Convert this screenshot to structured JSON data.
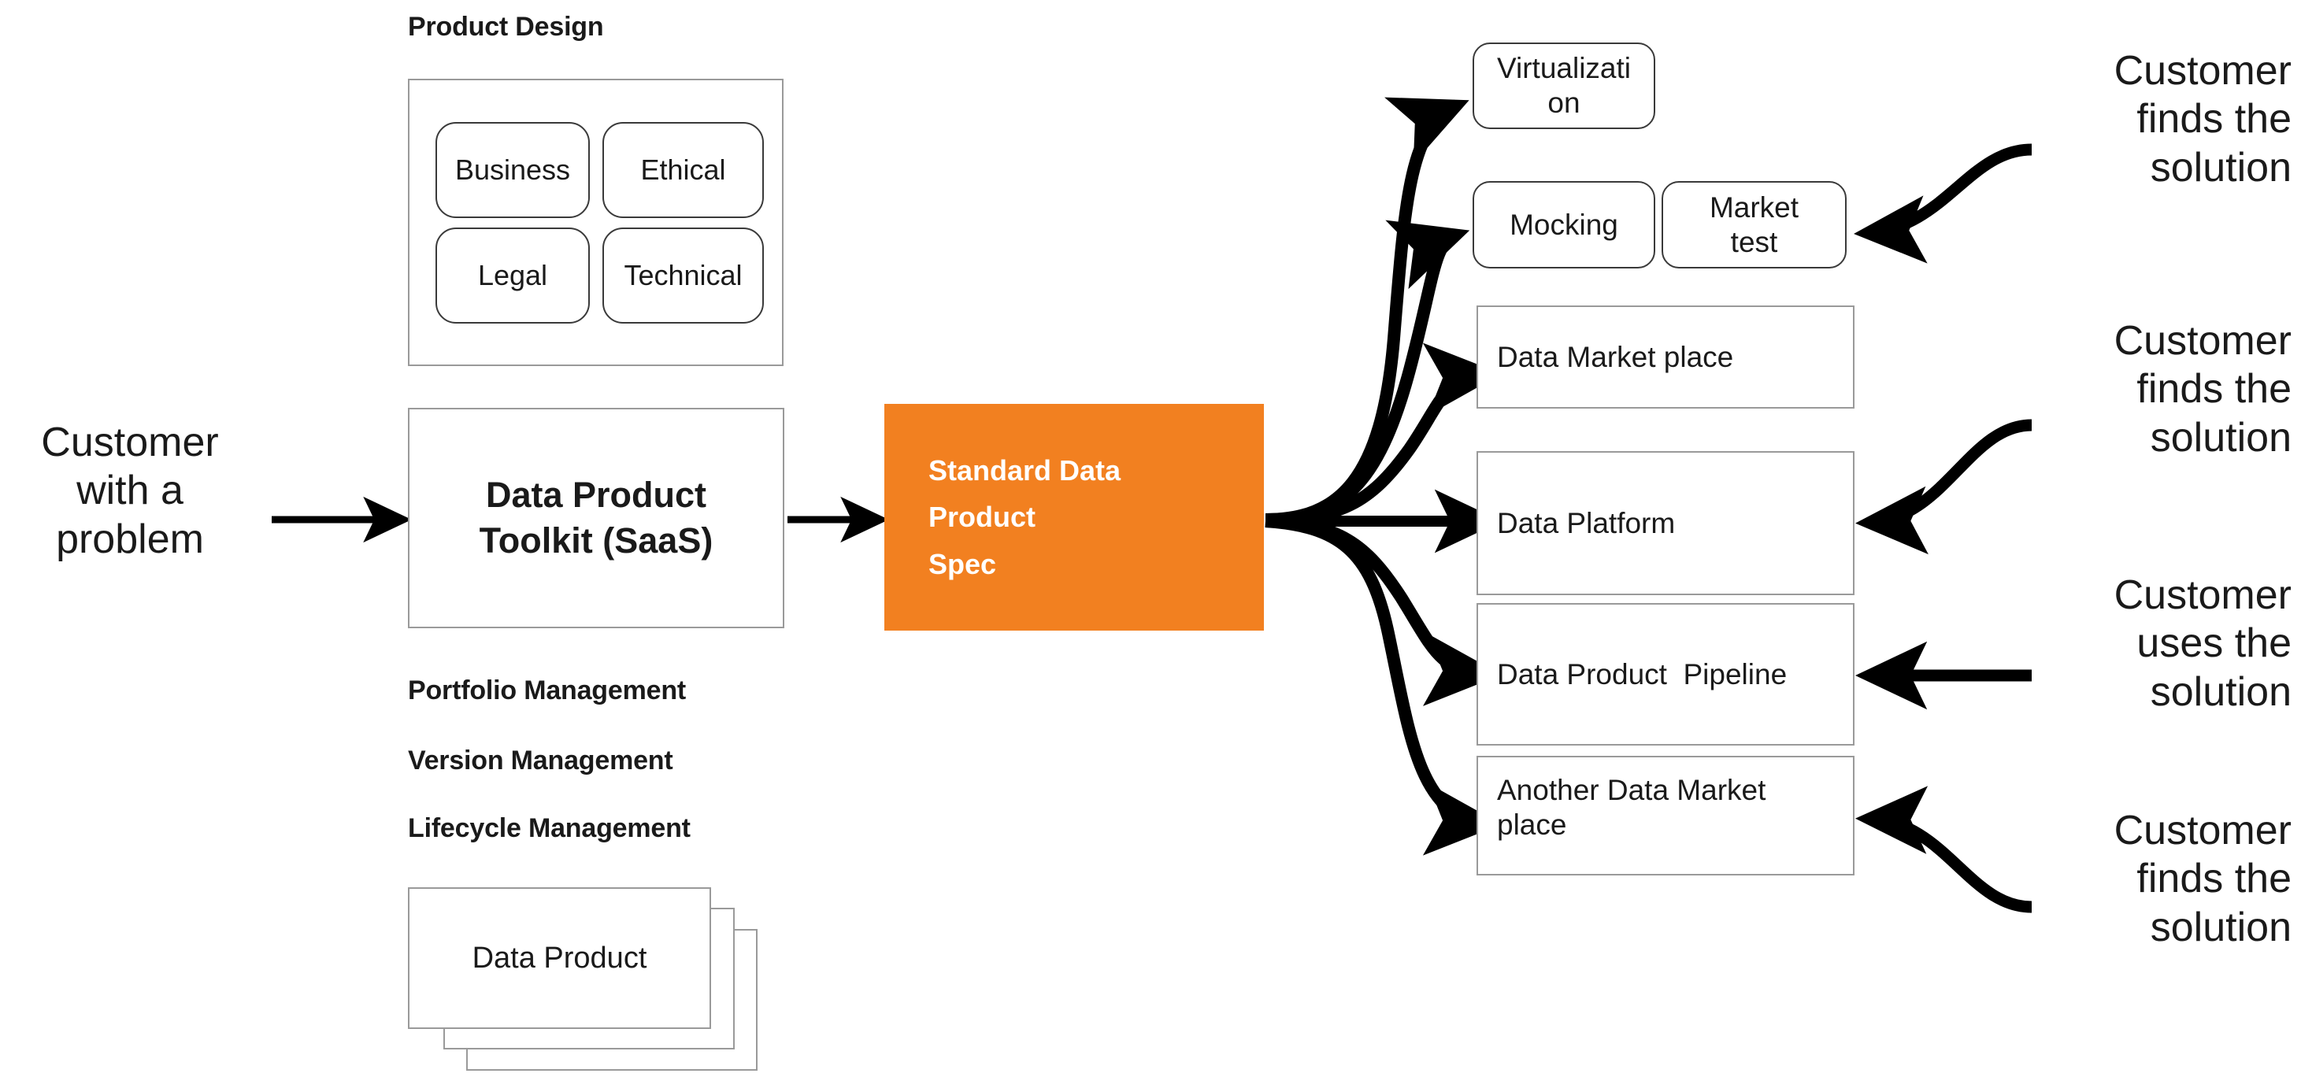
{
  "diagram": {
    "title": "Data Product Toolkit flow",
    "colors": {
      "accent_orange": "#F28020",
      "box_border_gray": "#9a9a9a",
      "box_border_dark": "#3a3a3a",
      "text": "#1a1a1a",
      "arrow": "#000000",
      "background": "#ffffff"
    }
  },
  "left": {
    "customer_input": "Customer\nwith a\nproblem"
  },
  "product_design": {
    "heading": "Product Design",
    "facets": [
      {
        "label": "Business"
      },
      {
        "label": "Ethical"
      },
      {
        "label": "Legal"
      },
      {
        "label": "Technical"
      }
    ]
  },
  "toolkit": {
    "label": "Data Product\nToolkit (SaaS)"
  },
  "capabilities": [
    {
      "label": "Portfolio Management"
    },
    {
      "label": "Version Management"
    },
    {
      "label": "Lifecycle Management"
    }
  ],
  "data_product_stack": {
    "label": "Data Product",
    "card_count": 3
  },
  "spec": {
    "label": "Standard Data\nProduct\nSpec"
  },
  "outputs": [
    {
      "id": "virtualization",
      "label": "Virtualizati\non",
      "shape": "rounded"
    },
    {
      "id": "mocking",
      "label": "Mocking",
      "shape": "rounded"
    },
    {
      "id": "market-test",
      "label": "Market\ntest",
      "shape": "rounded"
    },
    {
      "id": "data-market-place",
      "label": "Data Market place",
      "shape": "rect"
    },
    {
      "id": "data-platform",
      "label": "Data Platform",
      "shape": "rect"
    },
    {
      "id": "data-product-pipeline",
      "label": "Data Product  Pipeline",
      "shape": "rect"
    },
    {
      "id": "another-data-market-place",
      "label": "Another Data Market\nplace",
      "shape": "rect"
    }
  ],
  "outcomes": [
    {
      "id": "outcome-1",
      "label": "Customer\nfinds the\nsolution"
    },
    {
      "id": "outcome-2",
      "label": "Customer\nfinds the\nsolution"
    },
    {
      "id": "outcome-3",
      "label": "Customer\nuses the\nsolution"
    },
    {
      "id": "outcome-4",
      "label": "Customer\nfinds the\nsolution"
    }
  ]
}
